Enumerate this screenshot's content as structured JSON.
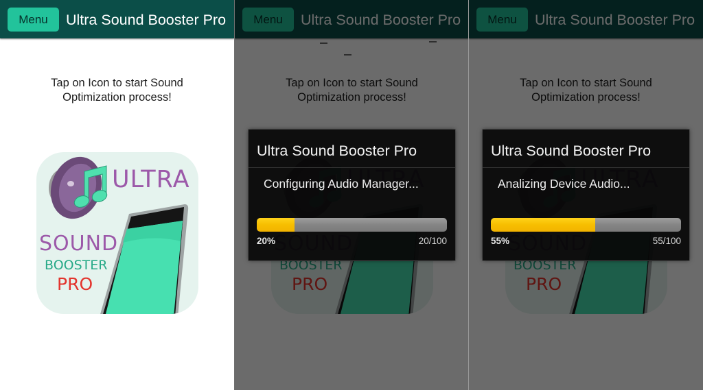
{
  "screens": [
    {
      "app_bar": {
        "menu_label": "Menu",
        "title": "Ultra Sound Booster Pro"
      },
      "instruction": {
        "line1": "Tap on Icon to start Sound",
        "line2": "Optimization process!"
      },
      "app_icon": {
        "words": [
          "ULTRA",
          "SOUND",
          "BOOSTER",
          "PRO"
        ],
        "icon": "speaker-music-note-phone-icon"
      },
      "dialog": null
    },
    {
      "app_bar": {
        "menu_label": "Menu",
        "title": "Ultra Sound Booster Pro"
      },
      "instruction": {
        "line1": "Tap on Icon to start Sound",
        "line2": "Optimization process!"
      },
      "app_icon": {
        "words": [
          "ULTRA",
          "SOUND",
          "BOOSTER",
          "PRO"
        ],
        "icon": "speaker-music-note-phone-icon"
      },
      "dialog": {
        "title": "Ultra Sound Booster Pro",
        "message": "Configuring Audio Manager...",
        "progress": {
          "value": 20,
          "max": 100,
          "percent_label": "20%",
          "count_label": "20/100"
        }
      }
    },
    {
      "app_bar": {
        "menu_label": "Menu",
        "title": "Ultra Sound Booster Pro"
      },
      "instruction": {
        "line1": "Tap on Icon to start Sound",
        "line2": "Optimization process!"
      },
      "app_icon": {
        "words": [
          "ULTRA",
          "SOUND",
          "BOOSTER",
          "PRO"
        ],
        "icon": "speaker-music-note-phone-icon"
      },
      "dialog": {
        "title": "Ultra Sound Booster Pro",
        "message": "Analizing Device Audio...",
        "progress": {
          "value": 55,
          "max": 100,
          "percent_label": "55%",
          "count_label": "55/100"
        }
      }
    }
  ],
  "colors": {
    "app_bar": "#0b4e48",
    "menu_button": "#22c39b",
    "progress_fill": "#f7be00",
    "progress_track": "#858585",
    "dialog_bg": "#080808",
    "icon_purple": "#9c59a9",
    "icon_green": "#26a987",
    "icon_red": "#e3342d"
  }
}
